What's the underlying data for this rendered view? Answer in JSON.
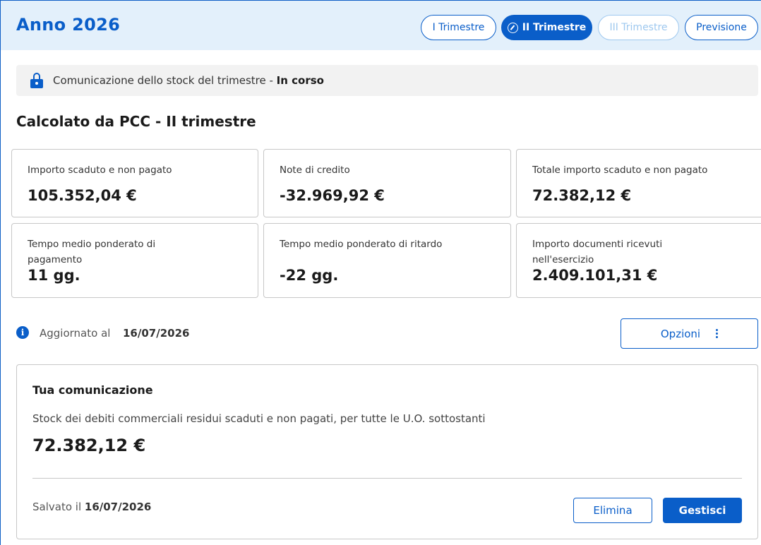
{
  "header": {
    "title": "Anno 2026",
    "tabs": [
      {
        "label": "I Trimestre",
        "state": "default"
      },
      {
        "label": "II Trimestre",
        "state": "active"
      },
      {
        "label": "III Trimestre",
        "state": "disabled"
      },
      {
        "label": "Previsione",
        "state": "default"
      }
    ]
  },
  "status": {
    "text": "Comunicazione dello stock del trimestre - ",
    "state": "In corso"
  },
  "section": {
    "title": "Calcolato da PCC - II trimestre"
  },
  "cards": [
    {
      "label": "Importo scaduto e non pagato",
      "value": "105.352,04 €"
    },
    {
      "label": "Note di credito",
      "value": "-32.969,92 €"
    },
    {
      "label": "Totale importo scaduto e non pagato",
      "value": "72.382,12 €"
    },
    {
      "label": "Tempo medio ponderato di pagamento",
      "value": "11 gg."
    },
    {
      "label": "Tempo medio ponderato di ritardo",
      "value": "-22 gg."
    },
    {
      "label": "Importo documenti ricevuti nell'esercizio",
      "value": "2.409.101,31 €"
    }
  ],
  "info": {
    "icon": "info-icon",
    "updated_label": "Aggiornato al",
    "updated_date": "16/07/2026",
    "options_label": "Opzioni"
  },
  "communication": {
    "title": "Tua comunicazione",
    "description": "Stock dei debiti commerciali residui scaduti e non pagati, per tutte le U.O. sottostanti",
    "amount": "72.382,12 €",
    "saved_label": "Salvato il ",
    "saved_date": "16/07/2026",
    "delete_label": "Elimina",
    "manage_label": "Gestisci"
  },
  "colors": {
    "primary": "#0a5ec9",
    "header_bg": "#e3f0fb",
    "disabled": "#9ec8ef"
  }
}
